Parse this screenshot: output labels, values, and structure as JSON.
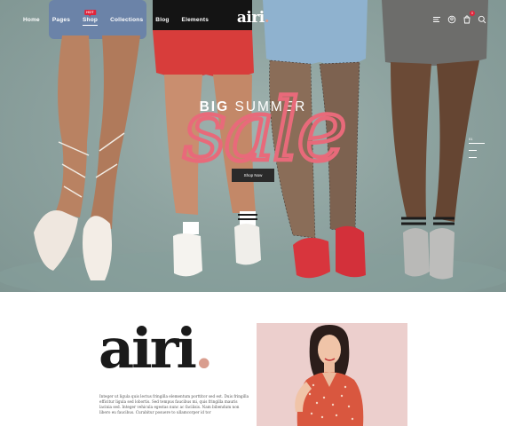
{
  "nav": {
    "items": [
      {
        "label": "Home",
        "active": false
      },
      {
        "label": "Pages",
        "active": false
      },
      {
        "label": "Shop",
        "active": true,
        "badge": "HOT"
      },
      {
        "label": "Collections",
        "active": false
      },
      {
        "label": "Blog",
        "active": false
      },
      {
        "label": "Elements",
        "active": false
      }
    ],
    "icons": [
      "menu-icon",
      "user-icon",
      "cart-icon",
      "search-icon"
    ],
    "cart_count": "0"
  },
  "brand": {
    "name": "airi",
    "dot": ".",
    "accent_color": "#d99d8e"
  },
  "hero": {
    "headline_bold": "BIG",
    "headline_light": " SUMMER",
    "script_word": "sale",
    "script_color": "#e86a7a",
    "button_label": "Shop Now",
    "slide_number": "01",
    "background_color": "#8ea3a0"
  },
  "about": {
    "logo": "airi",
    "logo_dot": ".",
    "text": "Integer ut ligula quis lectus fringilla elementum porttitor sed est. Duis fringilla efficitur ligula sed lobortis. Sed tempus faucibus mi, quis fringilla mauris lacinia sed. Integer vehicula egestas nunc ac facilisis. Nam bibendum non libero eu faucibus. Curabitur posuere to ullamcorper id tor"
  },
  "colors": {
    "hot_badge": "#e0243b",
    "button_bg": "#2a2a2a"
  }
}
